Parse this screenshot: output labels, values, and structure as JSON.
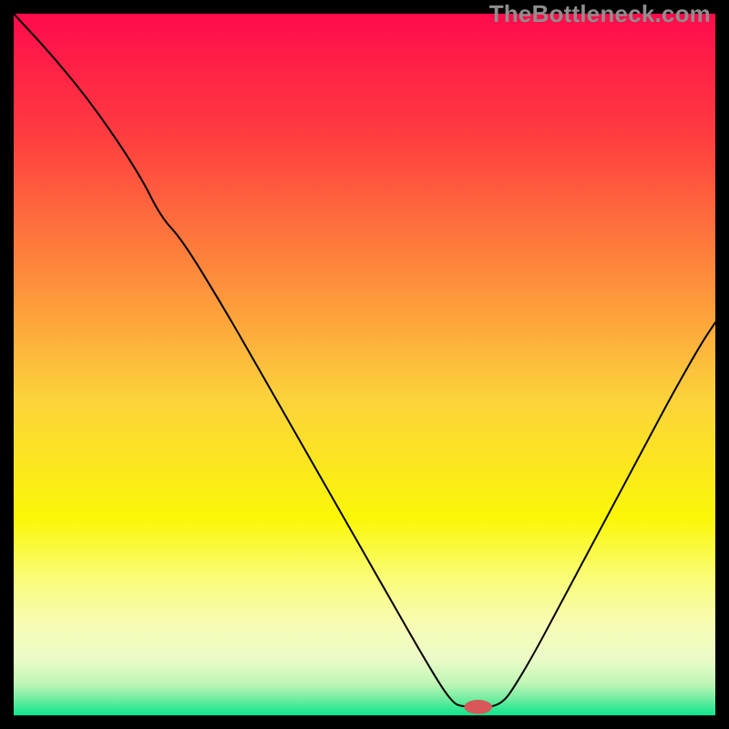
{
  "watermark": "TheBottleneck.com",
  "chart_data": {
    "type": "line",
    "title": "",
    "xlabel": "",
    "ylabel": "",
    "xlim": [
      0,
      100
    ],
    "ylim": [
      0,
      100
    ],
    "background_gradient": {
      "stops": [
        {
          "offset": 0.0,
          "color": "#ff0b4c"
        },
        {
          "offset": 0.18,
          "color": "#ff3f3f"
        },
        {
          "offset": 0.4,
          "color": "#fe963b"
        },
        {
          "offset": 0.55,
          "color": "#fcd33b"
        },
        {
          "offset": 0.72,
          "color": "#fbf707"
        },
        {
          "offset": 0.8,
          "color": "#fafc73"
        },
        {
          "offset": 0.87,
          "color": "#f7fcb4"
        },
        {
          "offset": 0.92,
          "color": "#ebfbc7"
        },
        {
          "offset": 0.955,
          "color": "#bff6b6"
        },
        {
          "offset": 0.975,
          "color": "#78eea2"
        },
        {
          "offset": 1.0,
          "color": "#0be48c"
        }
      ]
    },
    "series": [
      {
        "name": "bottleneck-curve",
        "stroke": "#000000",
        "stroke_width": 2,
        "points": [
          {
            "x": 0.0,
            "y": 100.0
          },
          {
            "x": 6.0,
            "y": 93.5
          },
          {
            "x": 12.0,
            "y": 86.0
          },
          {
            "x": 18.0,
            "y": 77.0
          },
          {
            "x": 21.0,
            "y": 71.0
          },
          {
            "x": 24.0,
            "y": 67.8
          },
          {
            "x": 30.0,
            "y": 58.0
          },
          {
            "x": 36.0,
            "y": 47.5
          },
          {
            "x": 42.0,
            "y": 37.0
          },
          {
            "x": 48.0,
            "y": 26.5
          },
          {
            "x": 54.0,
            "y": 16.0
          },
          {
            "x": 58.0,
            "y": 9.0
          },
          {
            "x": 61.0,
            "y": 4.0
          },
          {
            "x": 62.5,
            "y": 2.0
          },
          {
            "x": 63.5,
            "y": 1.3
          },
          {
            "x": 66.0,
            "y": 1.2
          },
          {
            "x": 68.3,
            "y": 1.2
          },
          {
            "x": 69.8,
            "y": 2.0
          },
          {
            "x": 71.0,
            "y": 3.5
          },
          {
            "x": 74.0,
            "y": 8.5
          },
          {
            "x": 78.0,
            "y": 16.0
          },
          {
            "x": 82.0,
            "y": 23.5
          },
          {
            "x": 86.0,
            "y": 31.0
          },
          {
            "x": 90.0,
            "y": 38.5
          },
          {
            "x": 94.0,
            "y": 46.0
          },
          {
            "x": 98.0,
            "y": 53.0
          },
          {
            "x": 100.0,
            "y": 56.0
          }
        ]
      }
    ],
    "marker": {
      "name": "optimal-point",
      "shape": "pill",
      "fill": "#d8575a",
      "cx": 66.2,
      "cy": 1.2,
      "rx": 2.0,
      "ry": 1.0
    }
  }
}
